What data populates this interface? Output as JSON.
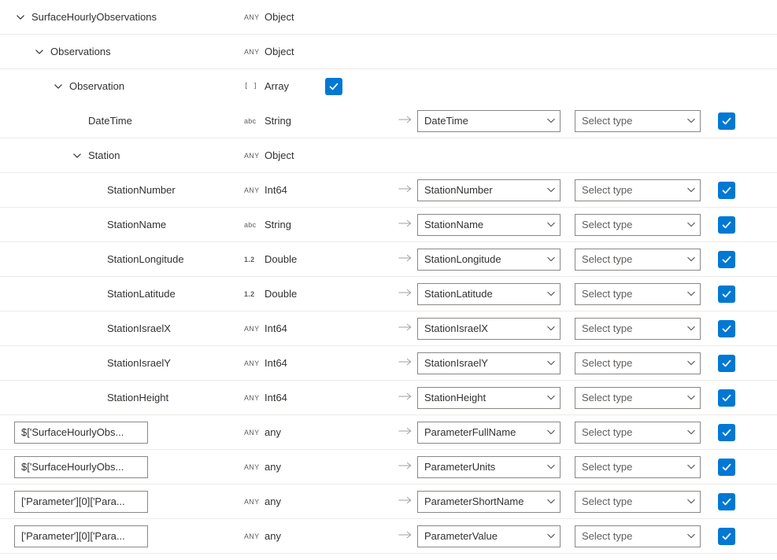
{
  "types": {
    "object": "Object",
    "array": "Array",
    "string": "String",
    "int64": "Int64",
    "double": "Double",
    "any": "any"
  },
  "badges": {
    "any": "ANY",
    "abc": "abc",
    "arr": "[ ]",
    "num": "1.2"
  },
  "selectTypePlaceholder": "Select type",
  "rows": [
    {
      "id": "root",
      "indent": 0,
      "name": "SurfaceHourlyObservations",
      "chevron": true,
      "typeBadge": "any",
      "type": "object",
      "hasMap": false,
      "inlineCheck": false
    },
    {
      "id": "obs",
      "indent": 1,
      "name": "Observations",
      "chevron": true,
      "typeBadge": "any",
      "type": "object",
      "hasMap": false,
      "inlineCheck": false
    },
    {
      "id": "observ",
      "indent": 2,
      "name": "Observation",
      "chevron": true,
      "typeBadge": "arr",
      "type": "array",
      "hasMap": false,
      "inlineCheck": true,
      "noBorder": true
    },
    {
      "id": "datetime",
      "indent": 3,
      "name": "DateTime",
      "chevron": false,
      "typeBadge": "abc",
      "type": "string",
      "hasMap": true,
      "mapValue": "DateTime"
    },
    {
      "id": "station",
      "indent": 3,
      "name": "Station",
      "chevron": true,
      "typeBadge": "any",
      "type": "object",
      "hasMap": false,
      "inlineCheck": false
    },
    {
      "id": "stnum",
      "indent": 4,
      "name": "StationNumber",
      "chevron": false,
      "typeBadge": "any",
      "type": "int64",
      "hasMap": true,
      "mapValue": "StationNumber"
    },
    {
      "id": "stname",
      "indent": 4,
      "name": "StationName",
      "chevron": false,
      "typeBadge": "abc",
      "type": "string",
      "hasMap": true,
      "mapValue": "StationName"
    },
    {
      "id": "stlon",
      "indent": 4,
      "name": "StationLongitude",
      "chevron": false,
      "typeBadge": "num",
      "type": "double",
      "hasMap": true,
      "mapValue": "StationLongitude"
    },
    {
      "id": "stlat",
      "indent": 4,
      "name": "StationLatitude",
      "chevron": false,
      "typeBadge": "num",
      "type": "double",
      "hasMap": true,
      "mapValue": "StationLatitude"
    },
    {
      "id": "stix",
      "indent": 4,
      "name": "StationIsraelX",
      "chevron": false,
      "typeBadge": "any",
      "type": "int64",
      "hasMap": true,
      "mapValue": "StationIsraelX"
    },
    {
      "id": "stiy",
      "indent": 4,
      "name": "StationIsraelY",
      "chevron": false,
      "typeBadge": "any",
      "type": "int64",
      "hasMap": true,
      "mapValue": "StationIsraelY"
    },
    {
      "id": "sth",
      "indent": 4,
      "name": "StationHeight",
      "chevron": false,
      "typeBadge": "any",
      "type": "int64",
      "hasMap": true,
      "mapValue": "StationHeight"
    },
    {
      "id": "p1",
      "indent": 0,
      "name": null,
      "pathLabel": "$['SurfaceHourlyObs...",
      "chevron": false,
      "typeBadge": "any",
      "type": "any",
      "hasMap": true,
      "mapValue": "ParameterFullName",
      "isPathRow": true
    },
    {
      "id": "p2",
      "indent": 0,
      "name": null,
      "pathLabel": "$['SurfaceHourlyObs...",
      "chevron": false,
      "typeBadge": "any",
      "type": "any",
      "hasMap": true,
      "mapValue": "ParameterUnits",
      "isPathRow": true
    },
    {
      "id": "p3",
      "indent": 0,
      "name": null,
      "pathLabel": "['Parameter'][0]['Para...",
      "chevron": false,
      "typeBadge": "any",
      "type": "any",
      "hasMap": true,
      "mapValue": "ParameterShortName",
      "isPathRow": true
    },
    {
      "id": "p4",
      "indent": 0,
      "name": null,
      "pathLabel": "['Parameter'][0]['Para...",
      "chevron": false,
      "typeBadge": "any",
      "type": "any",
      "hasMap": true,
      "mapValue": "ParameterValue",
      "isPathRow": true
    }
  ]
}
